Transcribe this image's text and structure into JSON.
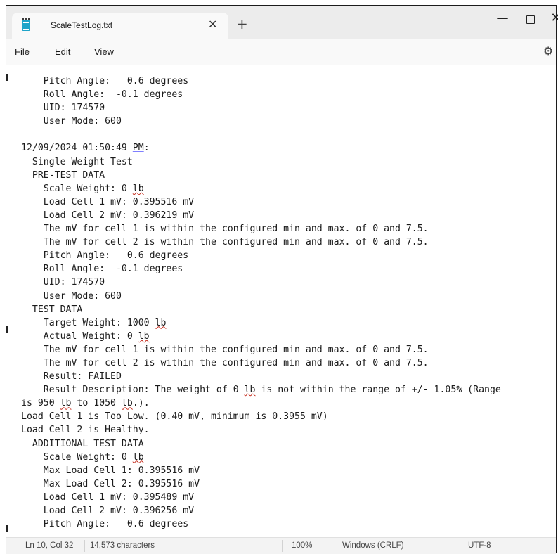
{
  "window": {
    "tab_title": "ScaleTestLog.txt",
    "tab_close": "✕",
    "new_tab": "+",
    "minimize": "—",
    "close": "✕"
  },
  "menu": {
    "file": "File",
    "edit": "Edit",
    "view": "View",
    "settings_icon": "gear-icon"
  },
  "editor": {
    "lines": [
      "    Pitch Angle:   0.6 degrees",
      "    Roll Angle:  -0.1 degrees",
      "    UID: 174570",
      "    User Mode: 600",
      "",
      "12/09/2024 01:50:49 PM:",
      "  Single Weight Test",
      "  PRE-TEST DATA",
      "    Scale Weight: 0 lb",
      "    Load Cell 1 mV: 0.395516 mV",
      "    Load Cell 2 mV: 0.396219 mV",
      "    The mV for cell 1 is within the configured min and max. of 0 and 7.5.",
      "    The mV for cell 2 is within the configured min and max. of 0 and 7.5.",
      "    Pitch Angle:   0.6 degrees",
      "    Roll Angle:  -0.1 degrees",
      "    UID: 174570",
      "    User Mode: 600",
      "  TEST DATA",
      "    Target Weight: 1000 lb",
      "    Actual Weight: 0 lb",
      "    The mV for cell 1 is within the configured min and max. of 0 and 7.5.",
      "    The mV for cell 2 is within the configured min and max. of 0 and 7.5.",
      "    Result: FAILED",
      "    Result Description: The weight of 0 lb is not within the range of +/- 1.05% (Range",
      "is 950 lb to 1050 lb.).",
      "Load Cell 1 is Too Low. (0.40 mV, minimum is 0.3955 mV)",
      "Load Cell 2 is Healthy.",
      "  ADDITIONAL TEST DATA",
      "    Scale Weight: 0 lb",
      "    Max Load Cell 1: 0.395516 mV",
      "    Max Load Cell 2: 0.395516 mV",
      "    Load Cell 1 mV: 0.395489 mV",
      "    Load Cell 2 mV: 0.396256 mV",
      "    Pitch Angle:   0.6 degrees"
    ]
  },
  "status": {
    "position": "Ln 10, Col 32",
    "characters": "14,573 characters",
    "zoom": "100%",
    "line_endings": "Windows (CRLF)",
    "encoding": "UTF-8"
  }
}
